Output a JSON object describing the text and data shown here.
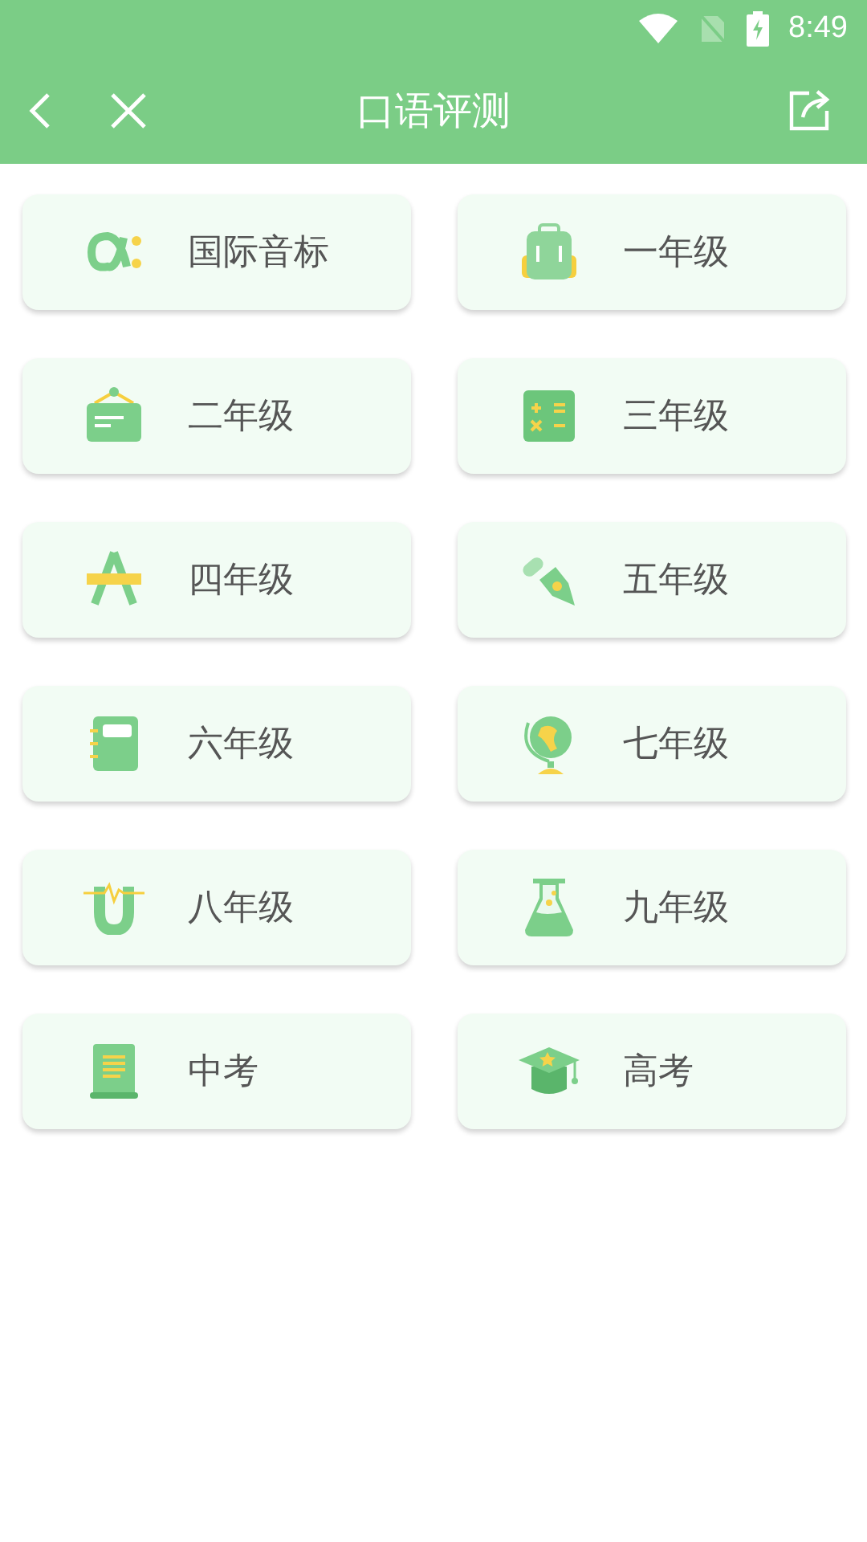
{
  "status_bar": {
    "time": "8:49"
  },
  "toolbar": {
    "title": "口语评测"
  },
  "items": [
    {
      "label": "国际音标",
      "kind": "alpha"
    },
    {
      "label": "一年级",
      "kind": "backpack"
    },
    {
      "label": "二年级",
      "kind": "board"
    },
    {
      "label": "三年级",
      "kind": "calculator"
    },
    {
      "label": "四年级",
      "kind": "compass"
    },
    {
      "label": "五年级",
      "kind": "pen"
    },
    {
      "label": "六年级",
      "kind": "notebook"
    },
    {
      "label": "七年级",
      "kind": "globe"
    },
    {
      "label": "八年级",
      "kind": "magnet"
    },
    {
      "label": "九年级",
      "kind": "flask"
    },
    {
      "label": "中考",
      "kind": "scroll"
    },
    {
      "label": "高考",
      "kind": "cap"
    }
  ]
}
